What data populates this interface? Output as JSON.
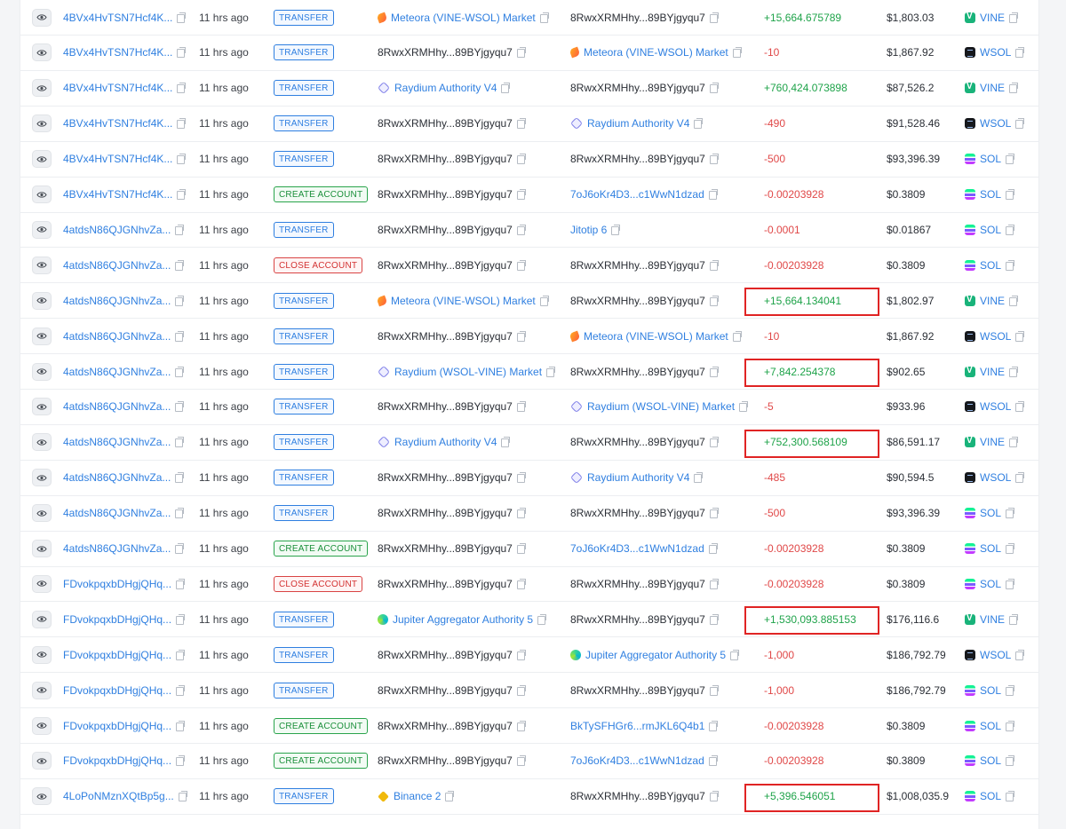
{
  "rows": [
    {
      "sig": "4BVx4HvTSN7Hcf4K...",
      "time": "11 hrs ago",
      "action": "TRANSFER",
      "action_kind": "transfer",
      "from": {
        "label": "Meteora (VINE-WSOL) Market",
        "icon": "meteora-icon",
        "link": true
      },
      "to": {
        "label": "8RwxXRMHhy...89BYjgyqu7",
        "icon": "",
        "link": false
      },
      "amount": "+15,664.675789",
      "sign": "pos",
      "value": "$1,803.03",
      "token": "VINE",
      "token_icon": "vine-icon"
    },
    {
      "sig": "4BVx4HvTSN7Hcf4K...",
      "time": "11 hrs ago",
      "action": "TRANSFER",
      "action_kind": "transfer",
      "from": {
        "label": "8RwxXRMHhy...89BYjgyqu7",
        "icon": "",
        "link": false
      },
      "to": {
        "label": "Meteora (VINE-WSOL) Market",
        "icon": "meteora-icon",
        "link": true
      },
      "amount": "-10",
      "sign": "neg",
      "value": "$1,867.92",
      "token": "WSOL",
      "token_icon": "wsol-icon"
    },
    {
      "sig": "4BVx4HvTSN7Hcf4K...",
      "time": "11 hrs ago",
      "action": "TRANSFER",
      "action_kind": "transfer",
      "from": {
        "label": "Raydium Authority V4",
        "icon": "raydium-icon",
        "link": true
      },
      "to": {
        "label": "8RwxXRMHhy...89BYjgyqu7",
        "icon": "",
        "link": false
      },
      "amount": "+760,424.073898",
      "sign": "pos",
      "value": "$87,526.2",
      "token": "VINE",
      "token_icon": "vine-icon"
    },
    {
      "sig": "4BVx4HvTSN7Hcf4K...",
      "time": "11 hrs ago",
      "action": "TRANSFER",
      "action_kind": "transfer",
      "from": {
        "label": "8RwxXRMHhy...89BYjgyqu7",
        "icon": "",
        "link": false
      },
      "to": {
        "label": "Raydium Authority V4",
        "icon": "raydium-icon",
        "link": true
      },
      "amount": "-490",
      "sign": "neg",
      "value": "$91,528.46",
      "token": "WSOL",
      "token_icon": "wsol-icon"
    },
    {
      "sig": "4BVx4HvTSN7Hcf4K...",
      "time": "11 hrs ago",
      "action": "TRANSFER",
      "action_kind": "transfer",
      "from": {
        "label": "8RwxXRMHhy...89BYjgyqu7",
        "icon": "",
        "link": false
      },
      "to": {
        "label": "8RwxXRMHhy...89BYjgyqu7",
        "icon": "",
        "link": false
      },
      "amount": "-500",
      "sign": "neg",
      "value": "$93,396.39",
      "token": "SOL",
      "token_icon": "sol-icon"
    },
    {
      "sig": "4BVx4HvTSN7Hcf4K...",
      "time": "11 hrs ago",
      "action": "CREATE ACCOUNT",
      "action_kind": "create",
      "from": {
        "label": "8RwxXRMHhy...89BYjgyqu7",
        "icon": "",
        "link": false
      },
      "to": {
        "label": "7oJ6oKr4D3...c1WwN1dzad",
        "icon": "",
        "link": true
      },
      "amount": "-0.00203928",
      "sign": "neg",
      "value": "$0.3809",
      "token": "SOL",
      "token_icon": "sol-icon"
    },
    {
      "sig": "4atdsN86QJGNhvZa...",
      "time": "11 hrs ago",
      "action": "TRANSFER",
      "action_kind": "transfer",
      "from": {
        "label": "8RwxXRMHhy...89BYjgyqu7",
        "icon": "",
        "link": false
      },
      "to": {
        "label": "Jitotip 6",
        "icon": "",
        "link": true
      },
      "amount": "-0.0001",
      "sign": "neg",
      "value": "$0.01867",
      "token": "SOL",
      "token_icon": "sol-icon"
    },
    {
      "sig": "4atdsN86QJGNhvZa...",
      "time": "11 hrs ago",
      "action": "CLOSE ACCOUNT",
      "action_kind": "close",
      "from": {
        "label": "8RwxXRMHhy...89BYjgyqu7",
        "icon": "",
        "link": false
      },
      "to": {
        "label": "8RwxXRMHhy...89BYjgyqu7",
        "icon": "",
        "link": false
      },
      "amount": "-0.00203928",
      "sign": "neg",
      "value": "$0.3809",
      "token": "SOL",
      "token_icon": "sol-icon"
    },
    {
      "sig": "4atdsN86QJGNhvZa...",
      "time": "11 hrs ago",
      "action": "TRANSFER",
      "action_kind": "transfer",
      "from": {
        "label": "Meteora (VINE-WSOL) Market",
        "icon": "meteora-icon",
        "link": true
      },
      "to": {
        "label": "8RwxXRMHhy...89BYjgyqu7",
        "icon": "",
        "link": false
      },
      "amount": "+15,664.134041",
      "sign": "pos",
      "value": "$1,802.97",
      "token": "VINE",
      "token_icon": "vine-icon",
      "highlighted": true
    },
    {
      "sig": "4atdsN86QJGNhvZa...",
      "time": "11 hrs ago",
      "action": "TRANSFER",
      "action_kind": "transfer",
      "from": {
        "label": "8RwxXRMHhy...89BYjgyqu7",
        "icon": "",
        "link": false
      },
      "to": {
        "label": "Meteora (VINE-WSOL) Market",
        "icon": "meteora-icon",
        "link": true
      },
      "amount": "-10",
      "sign": "neg",
      "value": "$1,867.92",
      "token": "WSOL",
      "token_icon": "wsol-icon"
    },
    {
      "sig": "4atdsN86QJGNhvZa...",
      "time": "11 hrs ago",
      "action": "TRANSFER",
      "action_kind": "transfer",
      "from": {
        "label": "Raydium (WSOL-VINE) Market",
        "icon": "raydium-icon",
        "link": true
      },
      "to": {
        "label": "8RwxXRMHhy...89BYjgyqu7",
        "icon": "",
        "link": false
      },
      "amount": "+7,842.254378",
      "sign": "pos",
      "value": "$902.65",
      "token": "VINE",
      "token_icon": "vine-icon",
      "highlighted": true
    },
    {
      "sig": "4atdsN86QJGNhvZa...",
      "time": "11 hrs ago",
      "action": "TRANSFER",
      "action_kind": "transfer",
      "from": {
        "label": "8RwxXRMHhy...89BYjgyqu7",
        "icon": "",
        "link": false
      },
      "to": {
        "label": "Raydium (WSOL-VINE) Market",
        "icon": "raydium-icon",
        "link": true
      },
      "amount": "-5",
      "sign": "neg",
      "value": "$933.96",
      "token": "WSOL",
      "token_icon": "wsol-icon"
    },
    {
      "sig": "4atdsN86QJGNhvZa...",
      "time": "11 hrs ago",
      "action": "TRANSFER",
      "action_kind": "transfer",
      "from": {
        "label": "Raydium Authority V4",
        "icon": "raydium-icon",
        "link": true
      },
      "to": {
        "label": "8RwxXRMHhy...89BYjgyqu7",
        "icon": "",
        "link": false
      },
      "amount": "+752,300.568109",
      "sign": "pos",
      "value": "$86,591.17",
      "token": "VINE",
      "token_icon": "vine-icon",
      "highlighted": true
    },
    {
      "sig": "4atdsN86QJGNhvZa...",
      "time": "11 hrs ago",
      "action": "TRANSFER",
      "action_kind": "transfer",
      "from": {
        "label": "8RwxXRMHhy...89BYjgyqu7",
        "icon": "",
        "link": false
      },
      "to": {
        "label": "Raydium Authority V4",
        "icon": "raydium-icon",
        "link": true
      },
      "amount": "-485",
      "sign": "neg",
      "value": "$90,594.5",
      "token": "WSOL",
      "token_icon": "wsol-icon"
    },
    {
      "sig": "4atdsN86QJGNhvZa...",
      "time": "11 hrs ago",
      "action": "TRANSFER",
      "action_kind": "transfer",
      "from": {
        "label": "8RwxXRMHhy...89BYjgyqu7",
        "icon": "",
        "link": false
      },
      "to": {
        "label": "8RwxXRMHhy...89BYjgyqu7",
        "icon": "",
        "link": false
      },
      "amount": "-500",
      "sign": "neg",
      "value": "$93,396.39",
      "token": "SOL",
      "token_icon": "sol-icon"
    },
    {
      "sig": "4atdsN86QJGNhvZa...",
      "time": "11 hrs ago",
      "action": "CREATE ACCOUNT",
      "action_kind": "create",
      "from": {
        "label": "8RwxXRMHhy...89BYjgyqu7",
        "icon": "",
        "link": false
      },
      "to": {
        "label": "7oJ6oKr4D3...c1WwN1dzad",
        "icon": "",
        "link": true
      },
      "amount": "-0.00203928",
      "sign": "neg",
      "value": "$0.3809",
      "token": "SOL",
      "token_icon": "sol-icon"
    },
    {
      "sig": "FDvokpqxbDHgjQHq...",
      "time": "11 hrs ago",
      "action": "CLOSE ACCOUNT",
      "action_kind": "close",
      "from": {
        "label": "8RwxXRMHhy...89BYjgyqu7",
        "icon": "",
        "link": false
      },
      "to": {
        "label": "8RwxXRMHhy...89BYjgyqu7",
        "icon": "",
        "link": false
      },
      "amount": "-0.00203928",
      "sign": "neg",
      "value": "$0.3809",
      "token": "SOL",
      "token_icon": "sol-icon"
    },
    {
      "sig": "FDvokpqxbDHgjQHq...",
      "time": "11 hrs ago",
      "action": "TRANSFER",
      "action_kind": "transfer",
      "from": {
        "label": "Jupiter Aggregator Authority 5",
        "icon": "jupiter-icon",
        "link": true
      },
      "to": {
        "label": "8RwxXRMHhy...89BYjgyqu7",
        "icon": "",
        "link": false
      },
      "amount": "+1,530,093.885153",
      "sign": "pos",
      "value": "$176,116.6",
      "token": "VINE",
      "token_icon": "vine-icon",
      "highlighted": true
    },
    {
      "sig": "FDvokpqxbDHgjQHq...",
      "time": "11 hrs ago",
      "action": "TRANSFER",
      "action_kind": "transfer",
      "from": {
        "label": "8RwxXRMHhy...89BYjgyqu7",
        "icon": "",
        "link": false
      },
      "to": {
        "label": "Jupiter Aggregator Authority 5",
        "icon": "jupiter-icon",
        "link": true
      },
      "amount": "-1,000",
      "sign": "neg",
      "value": "$186,792.79",
      "token": "WSOL",
      "token_icon": "wsol-icon"
    },
    {
      "sig": "FDvokpqxbDHgjQHq...",
      "time": "11 hrs ago",
      "action": "TRANSFER",
      "action_kind": "transfer",
      "from": {
        "label": "8RwxXRMHhy...89BYjgyqu7",
        "icon": "",
        "link": false
      },
      "to": {
        "label": "8RwxXRMHhy...89BYjgyqu7",
        "icon": "",
        "link": false
      },
      "amount": "-1,000",
      "sign": "neg",
      "value": "$186,792.79",
      "token": "SOL",
      "token_icon": "sol-icon"
    },
    {
      "sig": "FDvokpqxbDHgjQHq...",
      "time": "11 hrs ago",
      "action": "CREATE ACCOUNT",
      "action_kind": "create",
      "from": {
        "label": "8RwxXRMHhy...89BYjgyqu7",
        "icon": "",
        "link": false
      },
      "to": {
        "label": "BkTySFHGr6...rmJKL6Q4b1",
        "icon": "",
        "link": true
      },
      "amount": "-0.00203928",
      "sign": "neg",
      "value": "$0.3809",
      "token": "SOL",
      "token_icon": "sol-icon"
    },
    {
      "sig": "FDvokpqxbDHgjQHq...",
      "time": "11 hrs ago",
      "action": "CREATE ACCOUNT",
      "action_kind": "create",
      "from": {
        "label": "8RwxXRMHhy...89BYjgyqu7",
        "icon": "",
        "link": false
      },
      "to": {
        "label": "7oJ6oKr4D3...c1WwN1dzad",
        "icon": "",
        "link": true
      },
      "amount": "-0.00203928",
      "sign": "neg",
      "value": "$0.3809",
      "token": "SOL",
      "token_icon": "sol-icon"
    },
    {
      "sig": "4LoPoNMznXQtBp5g...",
      "time": "11 hrs ago",
      "action": "TRANSFER",
      "action_kind": "transfer",
      "from": {
        "label": "Binance 2",
        "icon": "binance-icon",
        "link": true
      },
      "to": {
        "label": "8RwxXRMHhy...89BYjgyqu7",
        "icon": "",
        "link": false
      },
      "amount": "+5,396.546051",
      "sign": "pos",
      "value": "$1,008,035.9",
      "token": "SOL",
      "token_icon": "sol-icon",
      "highlighted": true
    }
  ],
  "colors": {
    "link": "#2f7fe0",
    "positive": "#1fa34a",
    "negative": "#e04848",
    "highlight": "#e02424"
  }
}
